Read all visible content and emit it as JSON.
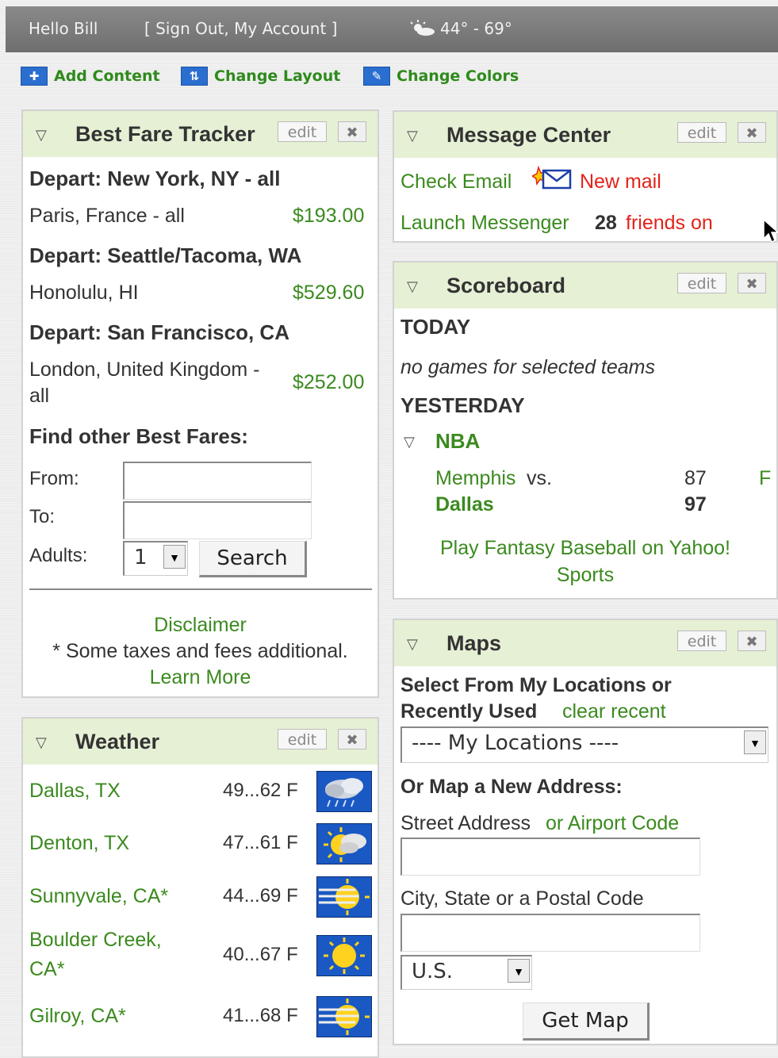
{
  "topbar": {
    "greeting": "Hello Bill",
    "account_links": "[ Sign Out, My Account ]",
    "weather_summary": "44° - 69°"
  },
  "toolbar": {
    "add_content": "Add Content",
    "change_layout": "Change Layout",
    "change_colors": "Change Colors"
  },
  "common": {
    "edit": "edit",
    "close": "✖",
    "collapse": "▽"
  },
  "fare": {
    "title": "Best Fare Tracker",
    "groups": [
      {
        "depart": "Depart: New York, NY - all",
        "dest": "Paris, France - all",
        "price": "$193.00"
      },
      {
        "depart": "Depart: Seattle/Tacoma, WA",
        "dest": "Honolulu, HI",
        "price": "$529.60"
      },
      {
        "depart": "Depart: San Francisco, CA",
        "dest_line1": "London, United Kingdom -",
        "dest_line2": "all",
        "price": "$252.00"
      }
    ],
    "find_heading": "Find other Best Fares:",
    "from_label": "From:",
    "to_label": "To:",
    "adults_label": "Adults:",
    "adults_value": "1",
    "search_button": "Search",
    "disclaimer": "Disclaimer",
    "taxes_note": "* Some taxes and fees additional.",
    "learn_more": "Learn More"
  },
  "weather": {
    "title": "Weather",
    "rows": [
      {
        "city": "Dallas, TX",
        "temp": "49...62 F",
        "icon": "rain-cloud-icon"
      },
      {
        "city": "Denton, TX",
        "temp": "47...61 F",
        "icon": "partly-cloudy-icon"
      },
      {
        "city": "Sunnyvale, CA*",
        "temp": "44...69 F",
        "icon": "sun-haze-icon"
      },
      {
        "city_line1": "Boulder Creek,",
        "city_line2": "CA*",
        "temp": "40...67 F",
        "icon": "sunny-icon"
      },
      {
        "city": "Gilroy, CA*",
        "temp": "41...68 F",
        "icon": "sun-haze-icon"
      }
    ]
  },
  "messages": {
    "title": "Message Center",
    "check_email": "Check Email",
    "new_mail": "New mail",
    "launch_messenger": "Launch Messenger",
    "friends_count": "28",
    "friends_on": "friends on"
  },
  "scoreboard": {
    "title": "Scoreboard",
    "today": "TODAY",
    "no_games": "no games for selected teams",
    "yesterday": "YESTERDAY",
    "league": "NBA",
    "team1": "Memphis",
    "vs": "vs.",
    "score1": "87",
    "status": "F",
    "team2": "Dallas",
    "score2": "97",
    "fantasy_line1": "Play Fantasy Baseball on Yahoo!",
    "fantasy_line2": "Sports"
  },
  "maps": {
    "title": "Maps",
    "select_line1": "Select From My Locations or",
    "select_line2": "Recently Used",
    "clear_recent": "clear recent",
    "locations_value": "---- My Locations ----",
    "new_address": "Or Map a New Address:",
    "street_label": "Street Address",
    "airport_code": "or Airport Code",
    "city_label": "City, State or a Postal Code",
    "country_value": "U.S.",
    "get_map": "Get Map"
  },
  "colors": {
    "link_green": "#3b8a1f",
    "alert_red": "#e2231a",
    "header_green": "#e6f0d5"
  }
}
